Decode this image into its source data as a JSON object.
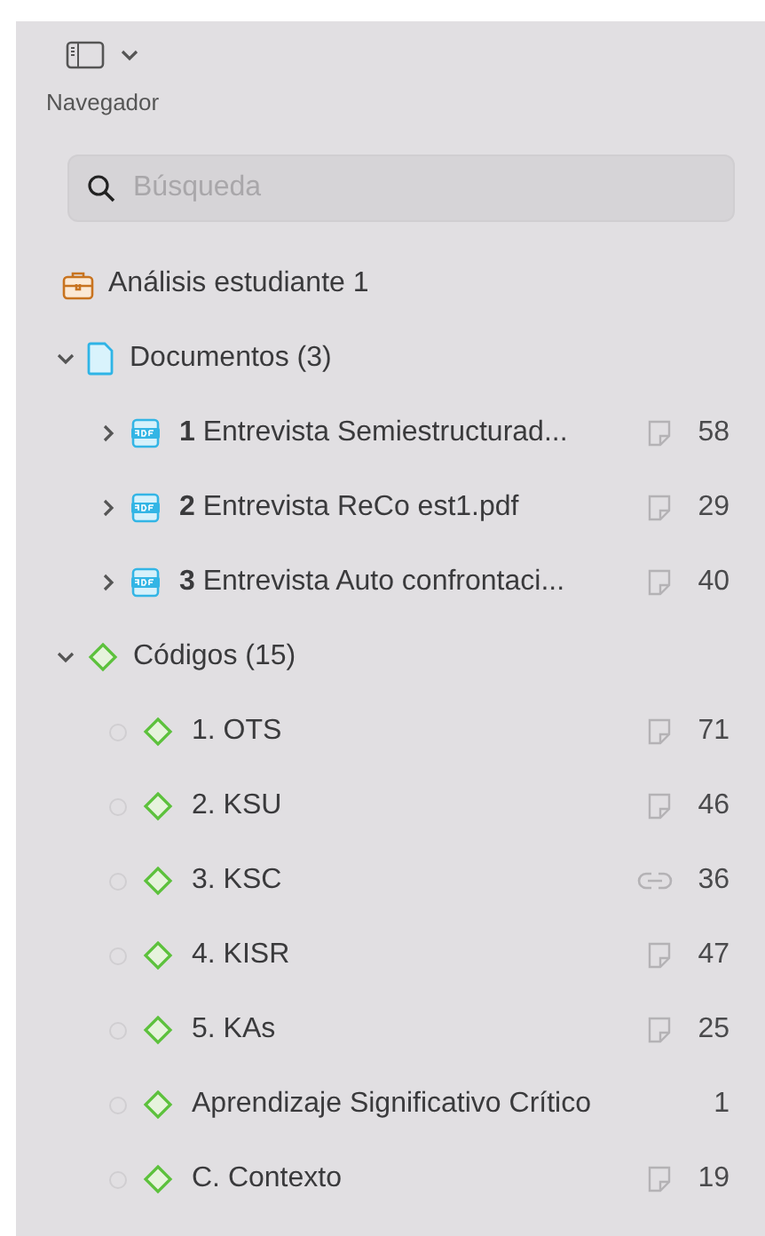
{
  "toolbar": {
    "label": "Navegador"
  },
  "search": {
    "placeholder": "Búsqueda"
  },
  "project": {
    "label": "Análisis estudiante 1"
  },
  "groups": [
    {
      "kind": "documents",
      "label": "Documentos (3)",
      "expanded": true,
      "items": [
        {
          "number": "1",
          "name": "Entrevista Semiestructurad...",
          "expanded": false,
          "kind": "memo",
          "count": "58"
        },
        {
          "number": "2",
          "name": "Entrevista ReCo est1.pdf",
          "expanded": false,
          "kind": "memo",
          "count": "29"
        },
        {
          "number": "3",
          "name": "Entrevista Auto confrontaci...",
          "expanded": false,
          "kind": "memo",
          "count": "40"
        }
      ]
    },
    {
      "kind": "codes",
      "label": "Códigos (15)",
      "expanded": true,
      "items": [
        {
          "name": "1. OTS",
          "kind": "memo",
          "count": "71"
        },
        {
          "name": "2. KSU",
          "kind": "memo",
          "count": "46"
        },
        {
          "name": "3. KSC",
          "kind": "link",
          "count": "36"
        },
        {
          "name": "4. KISR",
          "kind": "memo",
          "count": "47"
        },
        {
          "name": "5. KAs",
          "kind": "memo",
          "count": "25"
        },
        {
          "name": "Aprendizaje Significativo Crítico",
          "kind": "plain",
          "count": "1"
        },
        {
          "name": "C. Contexto",
          "kind": "memo",
          "count": "19"
        }
      ]
    }
  ]
}
